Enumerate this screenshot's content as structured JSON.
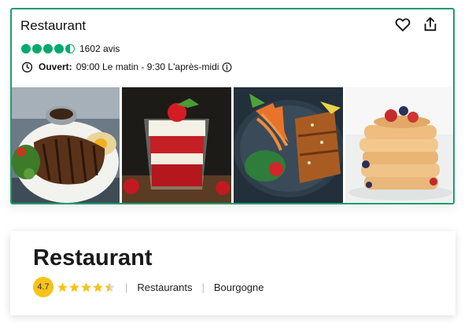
{
  "top_card": {
    "title": "Restaurant",
    "rating_bubbles": 4.5,
    "review_count": "1602 avis",
    "hours_label": "Ouvert:",
    "hours_value": "09:00 Le matin - 9:30 L'après-midi",
    "accent_color": "#1f9d6e",
    "bubble_color": "#00aa6c",
    "photos": [
      {
        "name": "grilled-steak-photo"
      },
      {
        "name": "strawberry-parfait-photo"
      },
      {
        "name": "chicken-salad-photo"
      },
      {
        "name": "pancakes-photo"
      }
    ]
  },
  "bottom_card": {
    "title": "Restaurant",
    "score": "4.7",
    "stars": 4.5,
    "star_color": "#f7c21b",
    "category": "Restaurants",
    "location": "Bourgogne"
  }
}
